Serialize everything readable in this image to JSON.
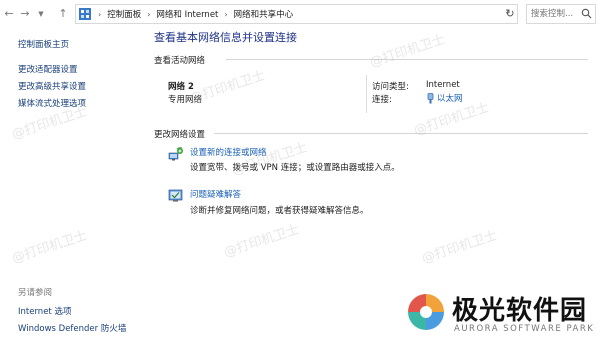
{
  "breadcrumb": [
    "控制面板",
    "网络和 Internet",
    "网络和共享中心"
  ],
  "search": {
    "placeholder": "搜索控制..."
  },
  "sidebar": {
    "items": [
      {
        "label": "控制面板主页"
      },
      {
        "label": "更改适配器设置"
      },
      {
        "label": "更改高级共享设置"
      },
      {
        "label": "媒体流式处理选项"
      }
    ],
    "see_also_title": "另请参阅",
    "see_also": [
      {
        "label": "Internet 选项"
      },
      {
        "label": "Windows Defender 防火墙"
      }
    ]
  },
  "main": {
    "title": "查看基本网络信息并设置连接",
    "active_networks_title": "查看活动网络",
    "network": {
      "name": "网络 2",
      "profile": "专用网络",
      "access_type_label": "访问类型:",
      "access_type_value": "Internet",
      "connections_label": "连接:",
      "connection_value": "以太网"
    },
    "change_settings_title": "更改网络设置",
    "tasks": [
      {
        "link": "设置新的连接或网络",
        "desc": "设置宽带、拨号或 VPN 连接；或设置路由器或接入点。",
        "icon": "network-setup-icon"
      },
      {
        "link": "问题疑难解答",
        "desc": "诊断并修复网络问题，或者获得疑难解答信息。",
        "icon": "troubleshoot-icon"
      }
    ]
  },
  "watermark": "@打印机卫士",
  "brand": {
    "name": "极光软件园",
    "tagline": "AURORA SOFTWARE PARK"
  },
  "colors": {
    "link": "#1a5fb4",
    "title": "#1e3287",
    "nav_link": "#1a3f7a"
  }
}
